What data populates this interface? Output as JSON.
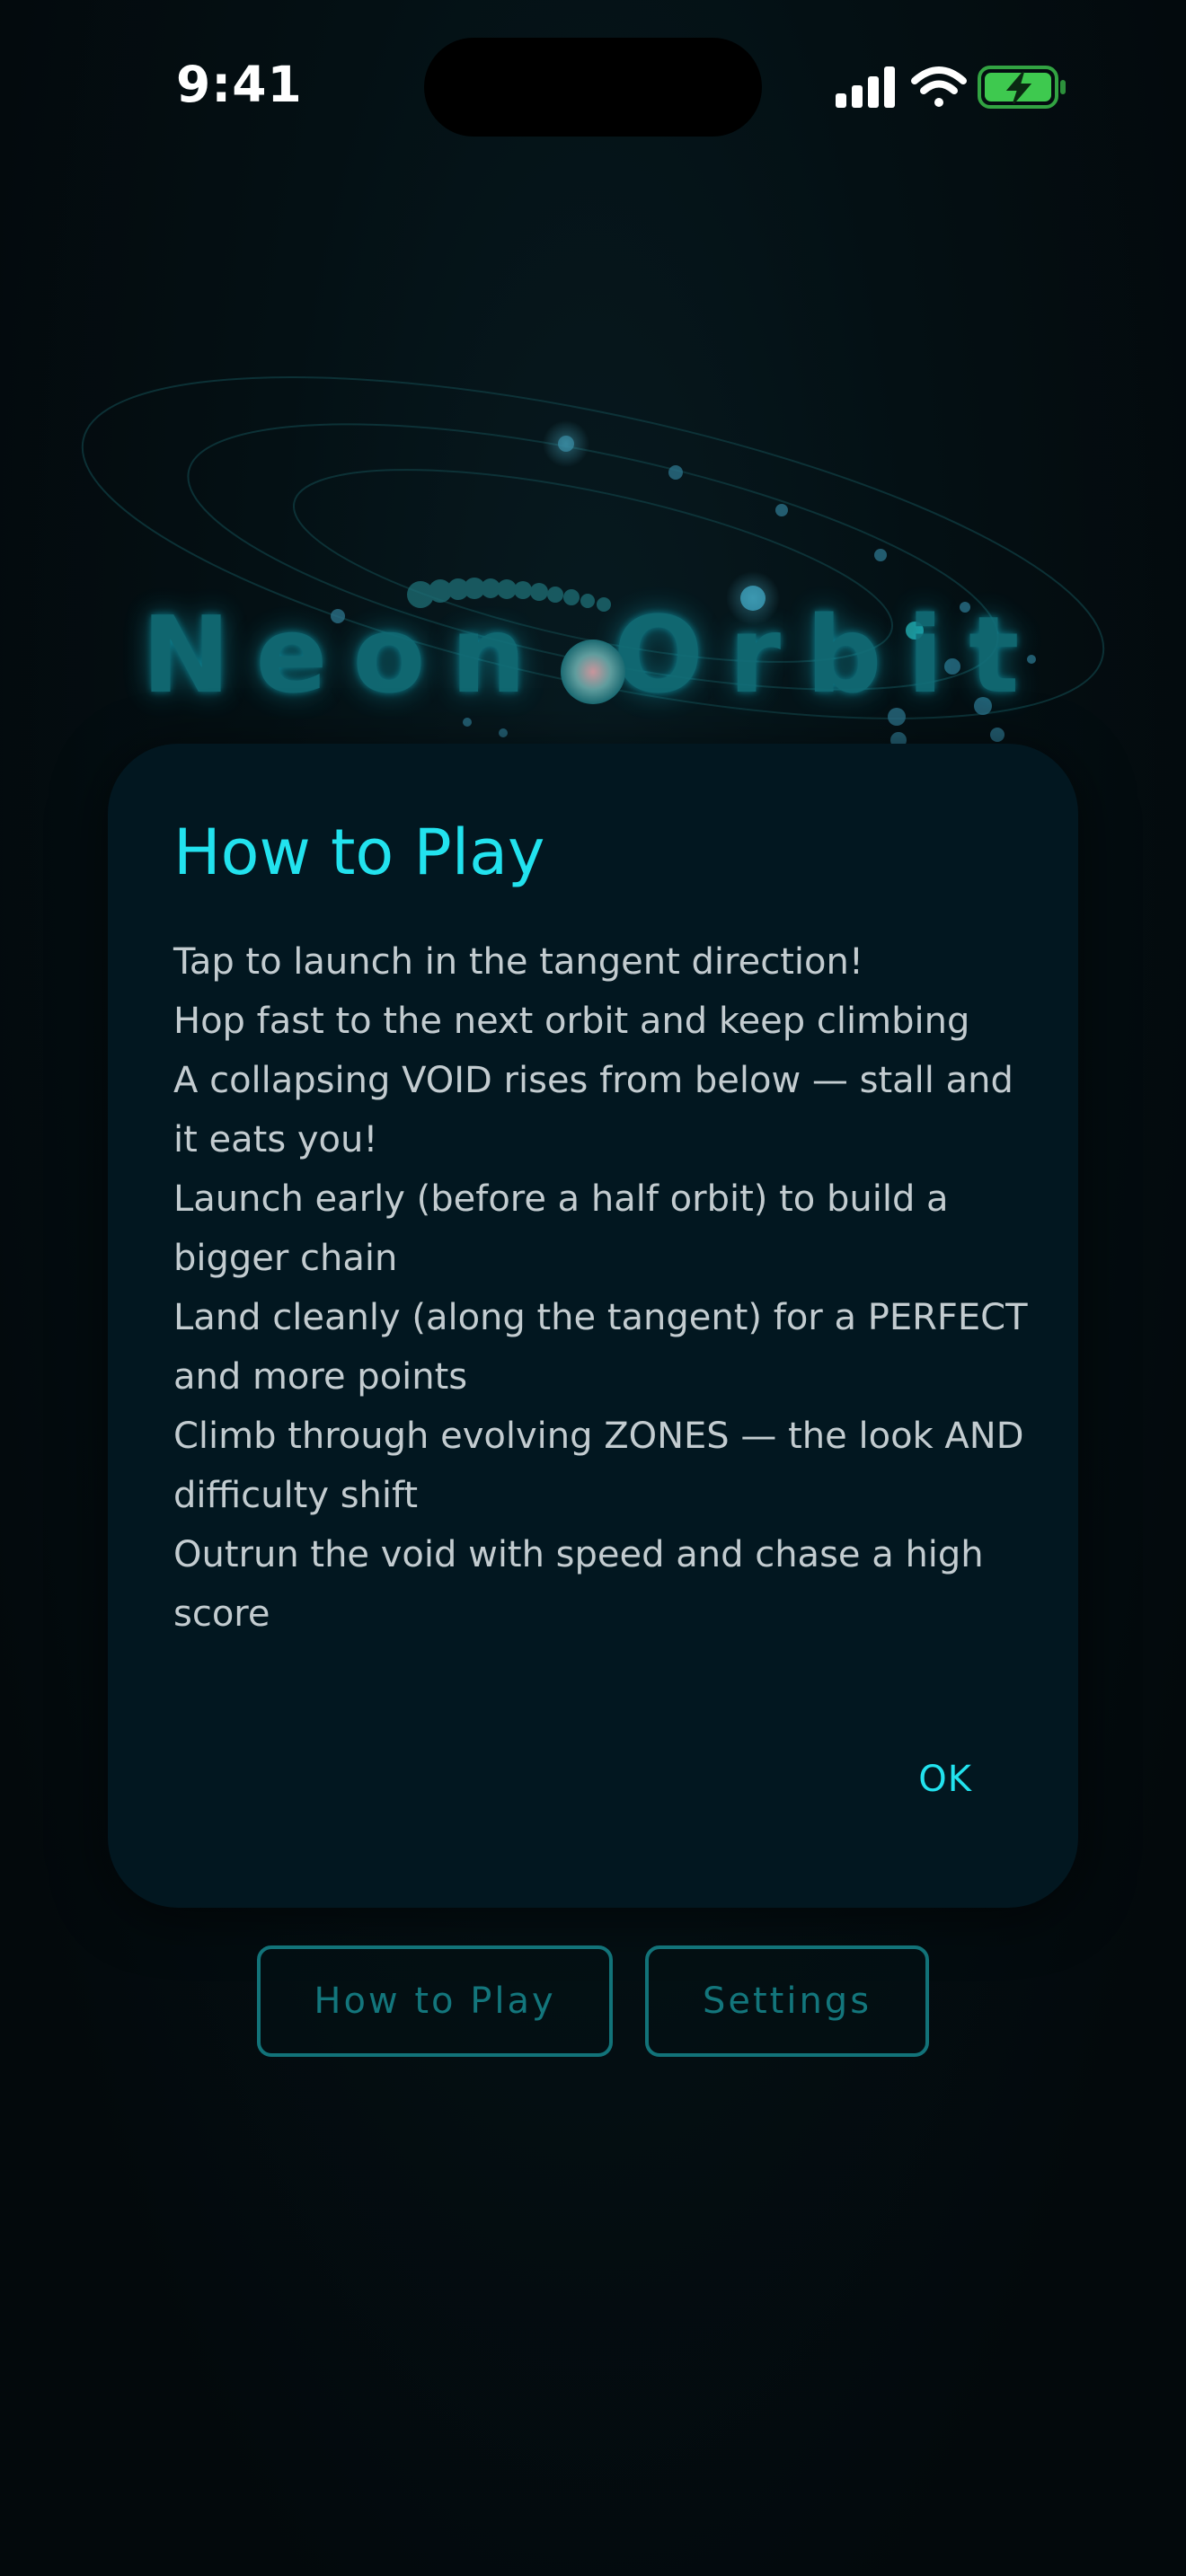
{
  "status_bar": {
    "time": "9:41",
    "icons": [
      "cellular-signal-icon",
      "wifi-icon",
      "battery-charging-icon"
    ]
  },
  "game": {
    "title": "Neon Orbit"
  },
  "dialog": {
    "title": "How to Play",
    "instructions": [
      "Tap to launch in the tangent direction!",
      "Hop fast to the next orbit and keep climbing",
      "A collapsing VOID rises from below — stall and it eats you!",
      "Launch early (before a half orbit) to build a bigger chain",
      "Land cleanly (along the tangent) for a PERFECT and more points",
      "Climb through evolving ZONES — the look AND difficulty shift",
      "Outrun the void with speed and chase a high score"
    ],
    "ok_label": "OK"
  },
  "menu": {
    "how_to_play_label": "How to Play",
    "settings_label": "Settings"
  },
  "colors": {
    "accent": "#22e2ee",
    "muted_accent": "#13767c",
    "dialog_bg": "#021720",
    "screen_bg": "#03090c",
    "battery_green": "#3ec94f"
  }
}
